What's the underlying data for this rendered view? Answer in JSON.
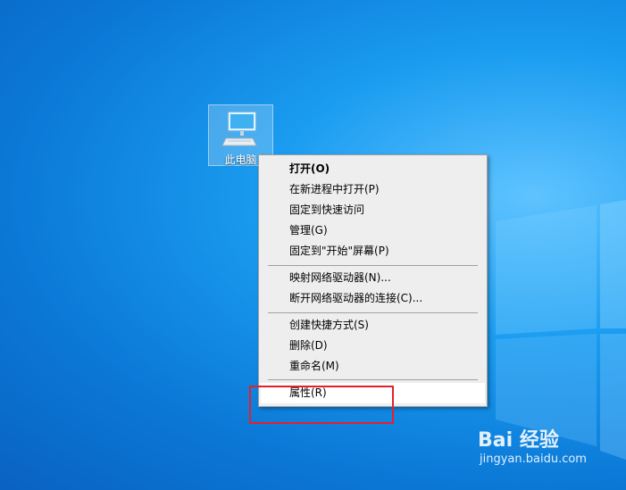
{
  "desktop": {
    "icon_label": "此电脑"
  },
  "context_menu": {
    "items": [
      {
        "label": "打开(O)"
      },
      {
        "label": "在新进程中打开(P)"
      },
      {
        "label": "固定到快速访问"
      },
      {
        "label": "管理(G)"
      },
      {
        "label": "固定到\"开始\"屏幕(P)"
      },
      {
        "label": "映射网络驱动器(N)..."
      },
      {
        "label": "断开网络驱动器的连接(C)..."
      },
      {
        "label": "创建快捷方式(S)"
      },
      {
        "label": "删除(D)"
      },
      {
        "label": "重命名(M)"
      },
      {
        "label": "属性(R)"
      }
    ],
    "highlighted": "属性(R)"
  },
  "watermark": {
    "logo_text": "Bai 经验",
    "url": "jingyan.baidu.com"
  },
  "colors": {
    "annotation_box": "#e5202a",
    "menu_background": "#eeeeee"
  }
}
